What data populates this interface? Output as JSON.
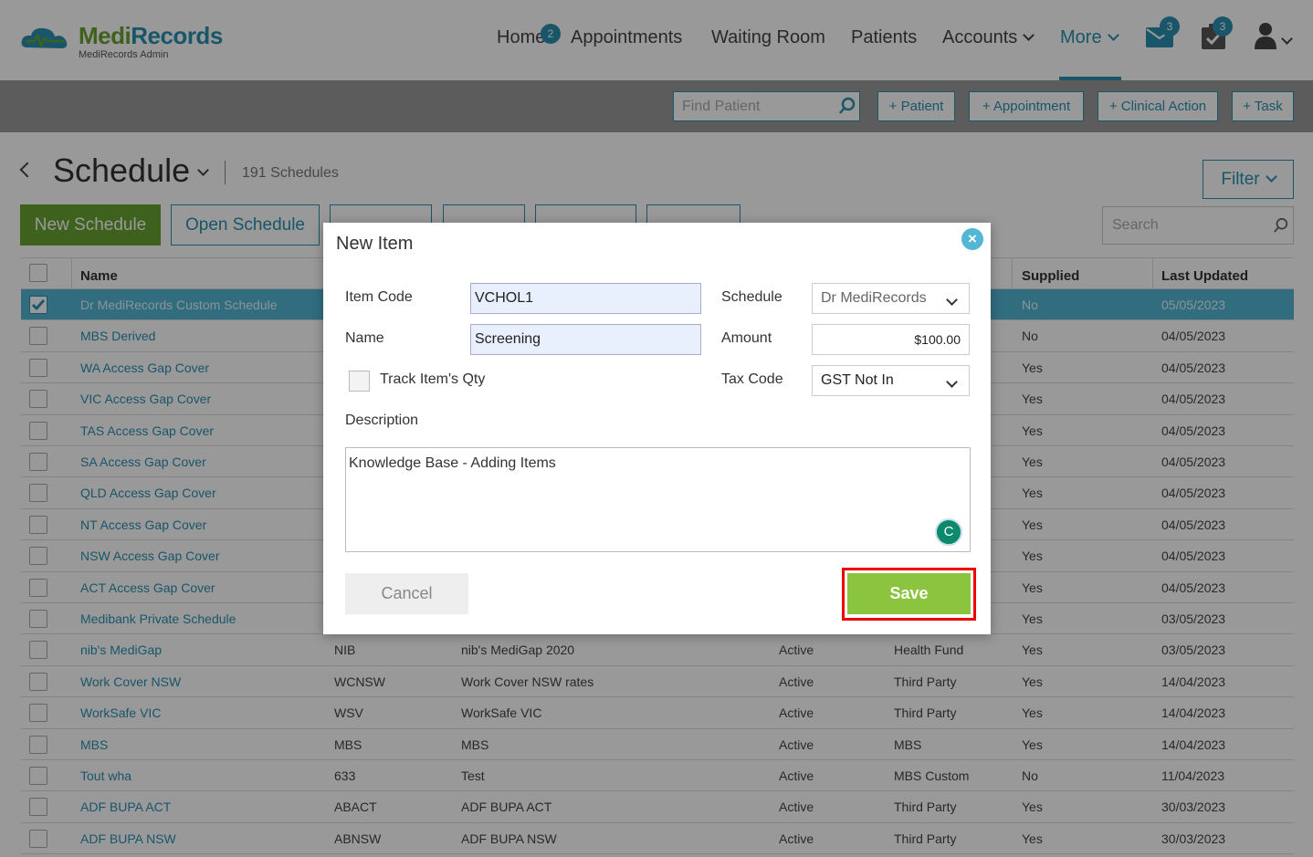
{
  "app": {
    "logo_name": "MediRecords",
    "logo_sub": "MediRecords Admin"
  },
  "nav": {
    "home": "Home",
    "home_badge": "2",
    "appointments": "Appointments",
    "waiting_room": "Waiting Room",
    "patients": "Patients",
    "accounts": "Accounts",
    "more": "More",
    "mail_badge": "3",
    "tasks_badge": "3"
  },
  "actionbar": {
    "find_placeholder": "Find Patient",
    "add_patient": "+ Patient",
    "add_appointment": "+ Appointment",
    "add_clinical_action": "+ Clinical Action",
    "add_task": "+ Task"
  },
  "page": {
    "title": "Schedule",
    "count": "191 Schedules",
    "filter": "Filter",
    "new_schedule": "New Schedule",
    "open_schedule": "Open Schedule",
    "search_placeholder": "Search"
  },
  "table": {
    "headers": {
      "name": "Name",
      "supplied": "Supplied",
      "last_updated": "Last Updated"
    },
    "rows": [
      {
        "name": "Dr MediRecords Custom Schedule",
        "code": "",
        "desc": "",
        "status": "",
        "type": "",
        "supplied": "No",
        "updated": "05/05/2023",
        "checked": true
      },
      {
        "name": "MBS Derived",
        "code": "",
        "desc": "",
        "status": "",
        "type": "",
        "supplied": "No",
        "updated": "04/05/2023"
      },
      {
        "name": "WA Access Gap Cover",
        "code": "",
        "desc": "",
        "status": "",
        "type": "",
        "supplied": "Yes",
        "updated": "04/05/2023"
      },
      {
        "name": "VIC Access Gap Cover",
        "code": "",
        "desc": "",
        "status": "",
        "type": "",
        "supplied": "Yes",
        "updated": "04/05/2023"
      },
      {
        "name": "TAS Access Gap Cover",
        "code": "",
        "desc": "",
        "status": "",
        "type": "",
        "supplied": "Yes",
        "updated": "04/05/2023"
      },
      {
        "name": "SA Access Gap Cover",
        "code": "",
        "desc": "",
        "status": "",
        "type": "",
        "supplied": "Yes",
        "updated": "04/05/2023"
      },
      {
        "name": "QLD Access Gap Cover",
        "code": "",
        "desc": "",
        "status": "",
        "type": "",
        "supplied": "Yes",
        "updated": "04/05/2023"
      },
      {
        "name": "NT Access Gap Cover",
        "code": "",
        "desc": "",
        "status": "",
        "type": "",
        "supplied": "Yes",
        "updated": "04/05/2023"
      },
      {
        "name": "NSW Access Gap Cover",
        "code": "",
        "desc": "",
        "status": "",
        "type": "",
        "supplied": "Yes",
        "updated": "04/05/2023"
      },
      {
        "name": "ACT Access Gap Cover",
        "code": "",
        "desc": "",
        "status": "",
        "type": "",
        "supplied": "Yes",
        "updated": "04/05/2023"
      },
      {
        "name": "Medibank Private Schedule",
        "code": "",
        "desc": "",
        "status": "",
        "type": "",
        "supplied": "Yes",
        "updated": "03/05/2023"
      },
      {
        "name": "nib's MediGap",
        "code": "NIB",
        "desc": "nib's MediGap 2020",
        "status": "Active",
        "type": "Health Fund",
        "supplied": "Yes",
        "updated": "03/05/2023"
      },
      {
        "name": "Work Cover NSW",
        "code": "WCNSW",
        "desc": "Work Cover NSW rates",
        "status": "Active",
        "type": "Third Party",
        "supplied": "Yes",
        "updated": "14/04/2023"
      },
      {
        "name": "WorkSafe VIC",
        "code": "WSV",
        "desc": "WorkSafe VIC",
        "status": "Active",
        "type": "Third Party",
        "supplied": "Yes",
        "updated": "14/04/2023"
      },
      {
        "name": "MBS",
        "code": "MBS",
        "desc": "MBS",
        "status": "Active",
        "type": "MBS",
        "supplied": "Yes",
        "updated": "14/04/2023"
      },
      {
        "name": "Tout wha",
        "code": "633",
        "desc": "Test",
        "status": "Active",
        "type": "MBS Custom",
        "supplied": "No",
        "updated": "11/04/2023"
      },
      {
        "name": "ADF BUPA ACT",
        "code": "ABACT",
        "desc": "ADF BUPA ACT",
        "status": "Active",
        "type": "Third Party",
        "supplied": "Yes",
        "updated": "30/03/2023"
      },
      {
        "name": "ADF BUPA NSW",
        "code": "ABNSW",
        "desc": "ADF BUPA NSW",
        "status": "Active",
        "type": "Third Party",
        "supplied": "Yes",
        "updated": "30/03/2023"
      }
    ]
  },
  "modal": {
    "title": "New Item",
    "close": "×",
    "item_code_label": "Item Code",
    "item_code_value": "VCHOL1",
    "name_label": "Name",
    "name_value": "Screening",
    "track_qty_label": "Track Item's Qty",
    "schedule_label": "Schedule",
    "schedule_value": "Dr MediRecords",
    "amount_label": "Amount",
    "amount_value": "$100.00",
    "tax_code_label": "Tax Code",
    "tax_code_value": "GST Not In",
    "description_label": "Description",
    "description_value": "Knowledge Base - Adding Items",
    "grammarly": "C",
    "cancel": "Cancel",
    "save": "Save"
  },
  "colors": {
    "brand_blue": "#2a8fb0",
    "brand_green": "#6aa233",
    "save_green": "#8bc540",
    "highlight_red": "#e00000",
    "selected_row": "#52b6d4"
  }
}
